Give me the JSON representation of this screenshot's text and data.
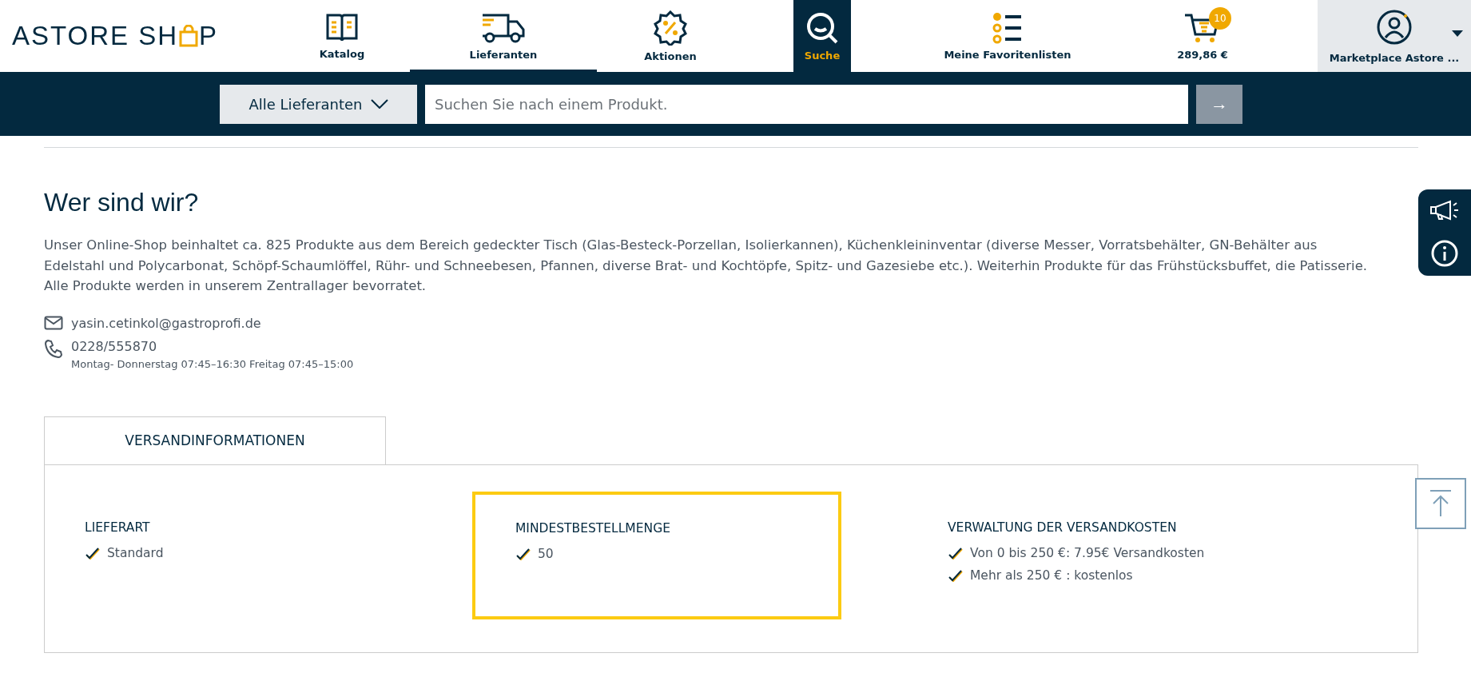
{
  "logo": {
    "text_before": "ASTORE SH",
    "text_after": "P"
  },
  "nav": [
    {
      "label": "Katalog",
      "kind": "catalog",
      "selected": false
    },
    {
      "label": "Lieferanten",
      "kind": "truck",
      "selected": true
    },
    {
      "label": "Aktionen",
      "kind": "promo",
      "selected": false
    },
    {
      "label": "Suche",
      "kind": "search",
      "selected": false
    },
    {
      "label": "Meine Favoritenlisten",
      "kind": "list",
      "selected": false
    }
  ],
  "cart": {
    "badge": "10",
    "total": "289,86 €"
  },
  "account": {
    "label": "Marketplace Astore ..."
  },
  "search": {
    "scope": "Alle Lieferanten",
    "placeholder": "Suchen Sie nach einem Produkt.",
    "submit": "→"
  },
  "about": {
    "title": "Wer sind wir?",
    "text": "Unser Online-Shop beinhaltet ca. 825 Produkte aus dem Bereich gedeckter Tisch (Glas-Besteck-Porzellan, Isolierkannen), Küchenkleininventar (diverse Messer, Vorratsbehälter, GN-Behälter aus Edelstahl und Polycarbonat, Schöpf-Schaumlöffel, Rühr- und Schneebesen, Pfannen, diverse Brat- und Kochtöpfe, Spitz- und Gazesiebe etc.). Weiterhin Produkte für das Frühstücksbuffet, die Patisserie. Alle Produkte werden in unserem Zentrallager bevorratet.",
    "email": "yasin.cetinkol@gastroprofi.de",
    "phone": "0228/555870",
    "hours": "Montag- Donnerstag 07:45–16:30 Freitag 07:45–15:00"
  },
  "tabs": [
    {
      "label": "VERSANDINFORMATIONEN",
      "selected": true
    }
  ],
  "shipping": [
    {
      "title": "LIEFERART",
      "highlighted": false,
      "items": [
        "Standard"
      ]
    },
    {
      "title": "MINDESTBESTELLMENGE",
      "highlighted": true,
      "items": [
        "50"
      ]
    },
    {
      "title": "VERWALTUNG DER VERSANDKOSTEN",
      "highlighted": false,
      "items": [
        "Von 0 bis 250 €: 7.95€ Versandkosten",
        "Mehr als 250 € : kostenlos"
      ]
    }
  ]
}
